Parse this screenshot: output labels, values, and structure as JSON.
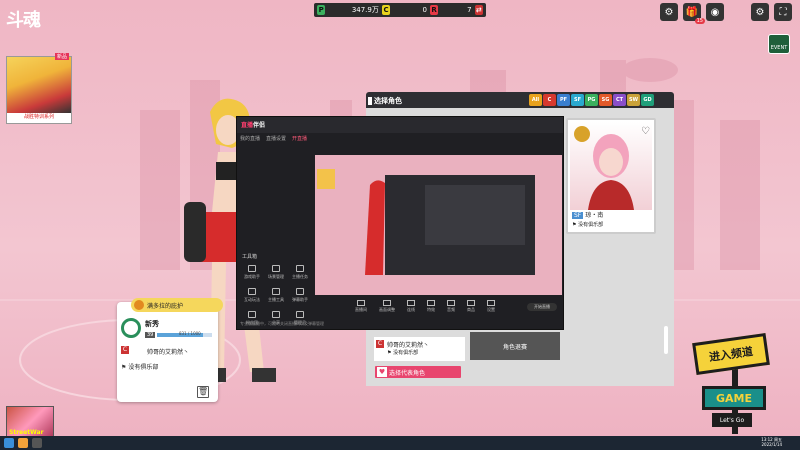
{
  "top": {
    "logo": "斗魂",
    "currency": {
      "p_label": "P",
      "p_value": "347.9万",
      "c_label": "C",
      "c_value": "0",
      "r_label": "R",
      "r_value": "7"
    },
    "badge_count": "15",
    "event_label": "EVENT"
  },
  "avatar": {
    "tag": "新品",
    "name": "战胜特训系列"
  },
  "info_card": {
    "header": "满多拉的庇护",
    "rank_name": "新秀",
    "level": "39",
    "exp": "831 / 1000",
    "exp_fraction": 0.83,
    "title": "帅哥的艾莉然丶",
    "club": "没有俱乐部"
  },
  "bottom_left": {
    "banner_text": "StreetWar"
  },
  "panel": {
    "title": "选择角色",
    "filters": [
      {
        "label": "All",
        "color": "#e8a21e"
      },
      {
        "label": "C",
        "color": "#d6392f"
      },
      {
        "label": "PF",
        "color": "#3a7fcf"
      },
      {
        "label": "SF",
        "color": "#2aa9cf"
      },
      {
        "label": "PG",
        "color": "#3bb05e"
      },
      {
        "label": "SG",
        "color": "#e35a2a"
      },
      {
        "label": "CT",
        "color": "#8a4fc9"
      },
      {
        "label": "SW",
        "color": "#c9a23a"
      },
      {
        "label": "GD",
        "color": "#1f9f7a"
      }
    ],
    "selected": {
      "badge": "SF",
      "name": "琼・南",
      "club": "没有俱乐部"
    },
    "card_left": {
      "tag": "C",
      "title": "帅哥的艾莉然丶",
      "club": "没有俱乐部"
    },
    "card_right": "角色退赛",
    "select_button": "选择代表角色"
  },
  "stream": {
    "logo_a": "直播",
    "logo_b": "伴侣",
    "tabs": [
      "我的直播",
      "直播设置",
      "开直播"
    ],
    "active_tab": 2,
    "tool_title": "工具箱",
    "tools": [
      "游戏助手",
      "场景管理",
      "主播任务",
      "互动玩法",
      "主播工具",
      "弹幕助手",
      "粉丝团",
      "分享",
      "管理员"
    ],
    "toolbar": [
      "直播间",
      "画面调整",
      "连线",
      "特效",
      "音频",
      "商品",
      "设置"
    ],
    "footer": "专业版直播中，可随时关闭直播间以及弹幕管理",
    "mini_button": "开始直播"
  },
  "sign": {
    "enter": "进入频道",
    "game": "GAME",
    "go": "Let's Go"
  },
  "taskbar": {
    "time": "13:12 周五",
    "date": "2022/1/14"
  }
}
